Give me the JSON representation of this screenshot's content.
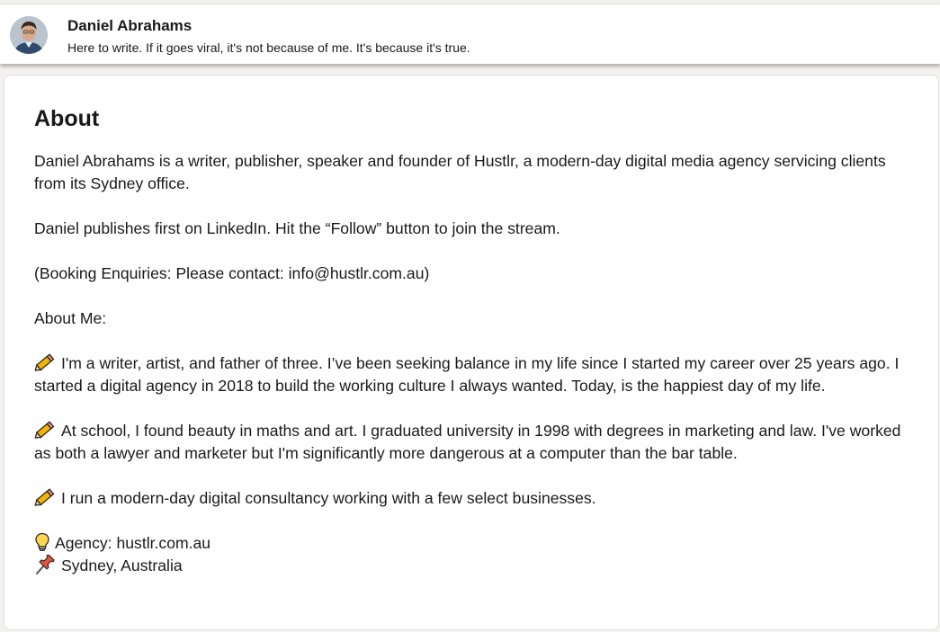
{
  "profile": {
    "name": "Daniel Abrahams",
    "headline": "Here to write. If it goes viral, it's not because of me. It's because it's true."
  },
  "about": {
    "title": "About",
    "intro": "Daniel Abrahams is a writer, publisher, speaker and founder of Hustlr, a modern-day digital media agency servicing clients from its Sydney office.",
    "follow_line": "Daniel publishes first on LinkedIn. Hit the “Follow” button to join the stream.",
    "booking_line": "(Booking Enquiries: Please contact: info@hustlr.com.au)",
    "about_me_heading": "About Me:",
    "bullets": [
      {
        "icon": "pencil-icon",
        "text": "I'm a writer, artist, and father of three. I’ve been seeking balance in my life since I started my career over 25 years ago. I started a digital agency in 2018 to build the working culture I always wanted. Today, is the happiest day of my life."
      },
      {
        "icon": "pencil-icon",
        "text": "At school, I found beauty in maths and art. I graduated university in 1998 with degrees in marketing and law. I've worked as both a lawyer and marketer but I'm significantly more dangerous at a computer than the bar table."
      },
      {
        "icon": "pencil-icon",
        "text": "I run a modern-day digital consultancy working with a few select businesses."
      }
    ],
    "agency_line": "Agency: hustlr.com.au",
    "location_line": "Sydney, Australia"
  },
  "colors": {
    "page_background": "#f3f2ef",
    "card_background": "#ffffff",
    "text": "#191919"
  }
}
